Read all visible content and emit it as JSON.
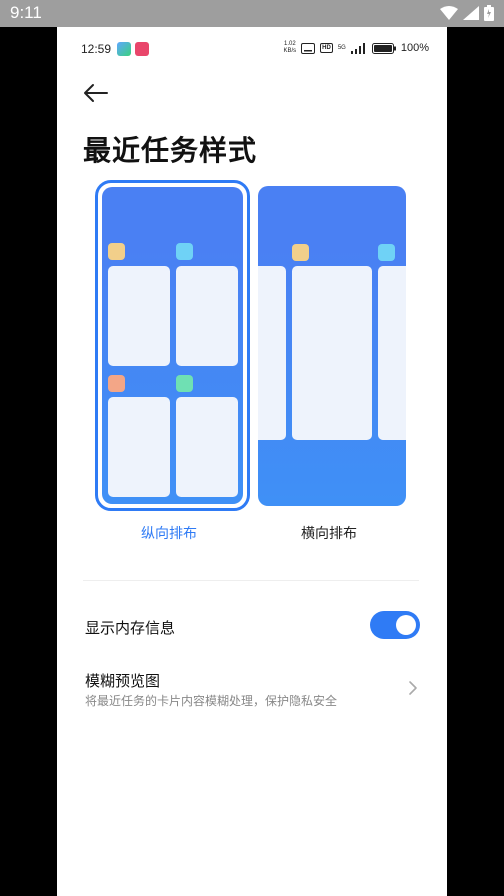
{
  "emulator": {
    "time": "9:11"
  },
  "status_bar": {
    "time": "12:59",
    "speed_top": "1.02",
    "speed_bottom": "KB/s",
    "hd": "HD",
    "network": "5G",
    "battery": "100%"
  },
  "page": {
    "title": "最近任务样式"
  },
  "layouts": [
    {
      "label": "纵向排布",
      "selected": true
    },
    {
      "label": "横向排布",
      "selected": false
    }
  ],
  "settings": {
    "show_memory": {
      "label": "显示内存信息",
      "enabled": true
    },
    "blur_preview": {
      "label": "模糊预览图",
      "description": "将最近任务的卡片内容模糊处理，保护隐私安全"
    }
  },
  "colors": {
    "accent": "#2f7bf5",
    "preview_blue": "#4a80f3",
    "tile": "#eef3fc",
    "dot_yellow": "#f2cf8a",
    "dot_cyan": "#6fd2f6",
    "dot_orange": "#f3a687",
    "dot_green": "#6fe0b3"
  }
}
